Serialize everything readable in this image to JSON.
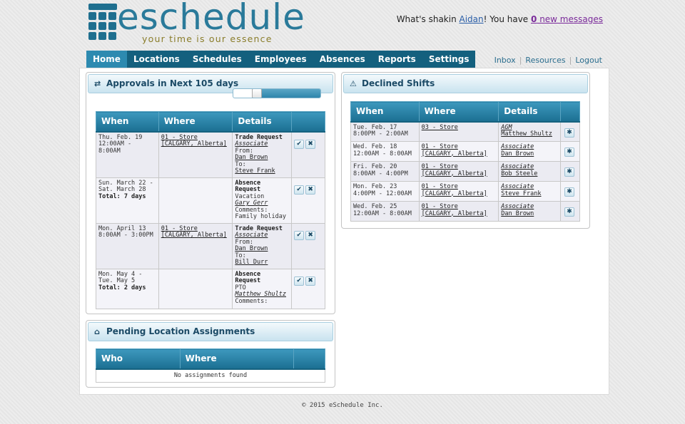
{
  "brand": {
    "logo_text": "eschedule",
    "tagline": "your time is our essence"
  },
  "greeting": {
    "prefix": "What's shakin ",
    "user": "Aidan",
    "middle": "! You have ",
    "msg_count": "0",
    "msg_suffix": " new messages"
  },
  "nav": {
    "items": [
      "Home",
      "Locations",
      "Schedules",
      "Employees",
      "Absences",
      "Reports",
      "Settings"
    ],
    "active": "Home"
  },
  "toplinks": [
    "Inbox",
    "Resources",
    "Logout"
  ],
  "approvals": {
    "title": "Approvals in Next 105 days",
    "slider_fraction": 0.72,
    "headers": [
      "When",
      "Where",
      "Details"
    ],
    "rows": [
      {
        "when_line1": "Thu. Feb. 19",
        "when_line2": "12:00AM - 8:00AM",
        "when_total": "",
        "where_line1": "01 - Store",
        "where_line2": "[CALGARY, Alberta]",
        "details": [
          {
            "t": "Trade Request",
            "style": "bold"
          },
          {
            "t": "Associate",
            "style": "ital"
          },
          {
            "t": "From:",
            "style": ""
          },
          {
            "t": "Dan Brown",
            "style": "link"
          },
          {
            "t": "To:",
            "style": ""
          },
          {
            "t": "Steve Frank",
            "style": "link"
          }
        ]
      },
      {
        "when_line1": "Sun. March 22 -",
        "when_line2": "Sat. March 28",
        "when_total": "Total: 7 days",
        "where_line1": "",
        "where_line2": "",
        "details": [
          {
            "t": "Absence",
            "style": "bold"
          },
          {
            "t": "Request",
            "style": "bold"
          },
          {
            "t": "Vacation",
            "style": ""
          },
          {
            "t": "Gary Gerr",
            "style": "ital"
          },
          {
            "t": "Comments:",
            "style": ""
          },
          {
            "t": "Family holiday",
            "style": ""
          }
        ]
      },
      {
        "when_line1": "Mon. April 13",
        "when_line2": "8:00AM - 3:00PM",
        "when_total": "",
        "where_line1": "01 - Store",
        "where_line2": "[CALGARY, Alberta]",
        "details": [
          {
            "t": "Trade Request",
            "style": "bold"
          },
          {
            "t": "Associate",
            "style": "ital"
          },
          {
            "t": "From:",
            "style": ""
          },
          {
            "t": "Dan Brown",
            "style": "link"
          },
          {
            "t": "To:",
            "style": ""
          },
          {
            "t": "Bill Durr",
            "style": "link"
          }
        ]
      },
      {
        "when_line1": "Mon. May 4 -",
        "when_line2": "Tue. May 5",
        "when_total": "Total: 2 days",
        "where_line1": "",
        "where_line2": "",
        "details": [
          {
            "t": "Absence",
            "style": "bold"
          },
          {
            "t": "Request",
            "style": "bold"
          },
          {
            "t": "PTO",
            "style": ""
          },
          {
            "t": "Matthew Shultz",
            "style": "ital"
          },
          {
            "t": "Comments:",
            "style": ""
          }
        ]
      }
    ]
  },
  "pending": {
    "title": "Pending Location Assignments",
    "headers": [
      "Who",
      "Where"
    ],
    "empty_text": "No assignments found"
  },
  "declined": {
    "title": "Declined Shifts",
    "headers": [
      "When",
      "Where",
      "Details"
    ],
    "rows": [
      {
        "when1": "Tue. Feb. 17",
        "when2": "8:00PM - 2:00AM",
        "where1": "03 - Store",
        "where2": "",
        "role": "AGM",
        "name": "Matthew Shultz"
      },
      {
        "when1": "Wed. Feb. 18",
        "when2": "12:00AM - 8:00AM",
        "where1": "01 - Store",
        "where2": "[CALGARY, Alberta]",
        "role": "Associate",
        "name": "Dan Brown"
      },
      {
        "when1": "Fri. Feb. 20",
        "when2": "8:00AM - 4:00PM",
        "where1": "01 - Store",
        "where2": "[CALGARY, Alberta]",
        "role": "Associate",
        "name": "Bob Steele"
      },
      {
        "when1": "Mon. Feb. 23",
        "when2": "4:00PM - 12:00AM",
        "where1": "01 - Store",
        "where2": "[CALGARY, Alberta]",
        "role": "Associate",
        "name": "Steve Frank"
      },
      {
        "when1": "Wed. Feb. 25",
        "when2": "12:00AM - 8:00AM",
        "where1": "01 - Store",
        "where2": "[CALGARY, Alberta]",
        "role": "Associate",
        "name": "Dan Brown"
      }
    ]
  },
  "footer": "© 2015 eSchedule Inc.",
  "colors": {
    "nav_bg": "#14607e",
    "nav_active": "#2d8ab0",
    "header_blue": "#1b6f92"
  }
}
